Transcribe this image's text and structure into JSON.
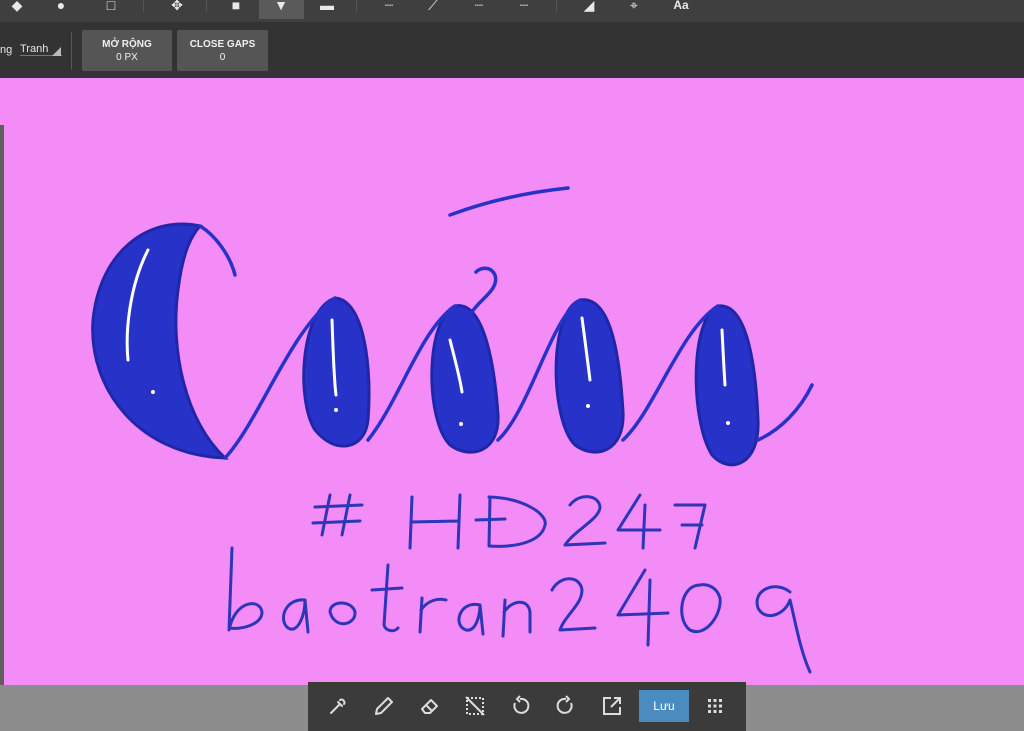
{
  "options_bar": {
    "left_label_partial": "ng",
    "mode_select_value": "Tranh",
    "expand_button": {
      "line1": "MỞ RỘNG",
      "line2": "0 PX"
    },
    "close_gaps_button": {
      "line1": "CLOSE GAPS",
      "line2": "0"
    }
  },
  "top_toolbar": {
    "icons": [
      "shape-icon",
      "smudge-icon",
      "frame-icon",
      "move-icon",
      "fill-rect-icon",
      "bucket-fill-icon",
      "gradient-icon",
      "selection-icon",
      "selection-pen-icon",
      "selection-dotted-icon",
      "selection-dashed-icon",
      "perspective-icon",
      "transform-icon",
      "text-icon"
    ],
    "text_tool_partial": "Aa"
  },
  "canvas": {
    "background": "#f48cf7",
    "drawing": {
      "word": "Cứu",
      "hashtag": "#HĐ247",
      "signature": "baotran2409",
      "ink_color": "#2732c8"
    }
  },
  "bottom_toolbar": {
    "icons": [
      "eyedropper-icon",
      "pencil-icon",
      "eraser-icon",
      "deselect-icon",
      "undo-icon",
      "redo-icon",
      "export-icon",
      "grid-menu-icon"
    ],
    "save_label": "Lưu",
    "save_color": "#4a8cc0"
  }
}
